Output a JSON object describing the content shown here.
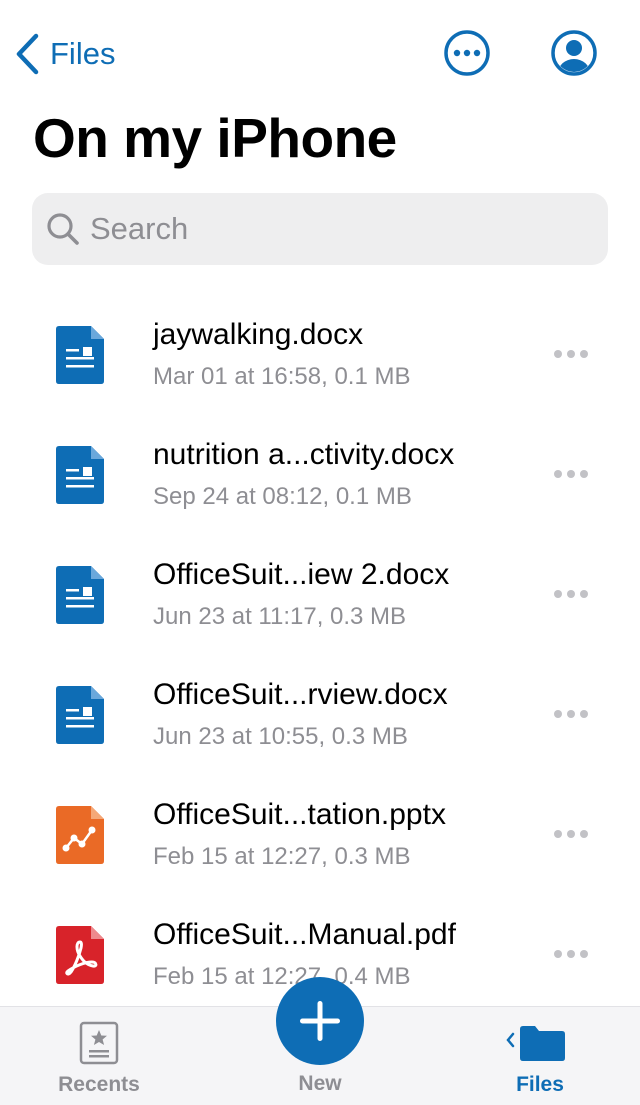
{
  "nav": {
    "back_label": "Files",
    "back_icon": "chevron-left-icon",
    "more_icon": "ellipsis-circle-icon",
    "account_icon": "person-circle-icon"
  },
  "page": {
    "title": "On my iPhone"
  },
  "search": {
    "placeholder": "Search",
    "value": ""
  },
  "files": [
    {
      "name": "jaywalking.docx",
      "meta": "Mar 01 at 16:58, 0.1 MB",
      "type": "docx"
    },
    {
      "name": "nutrition a...ctivity.docx",
      "meta": "Sep 24 at 08:12, 0.1 MB",
      "type": "docx"
    },
    {
      "name": "OfficeSuit...iew 2.docx",
      "meta": "Jun 23 at 11:17, 0.3 MB",
      "type": "docx"
    },
    {
      "name": "OfficeSuit...rview.docx",
      "meta": "Jun 23 at 10:55, 0.3 MB",
      "type": "docx"
    },
    {
      "name": "OfficeSuit...tation.pptx",
      "meta": "Feb 15 at 12:27, 0.3 MB",
      "type": "pptx"
    },
    {
      "name": "OfficeSuit...Manual.pdf",
      "meta": "Feb 15 at 12:27, 0.4 MB",
      "type": "pdf"
    }
  ],
  "tabs": {
    "recents": "Recents",
    "new": "New",
    "files": "Files"
  },
  "colors": {
    "accent": "#0e6db5",
    "docx": "#0e6db5",
    "pptx": "#ea6a26",
    "pdf": "#d8232a",
    "secondary_text": "#8e8e93"
  }
}
